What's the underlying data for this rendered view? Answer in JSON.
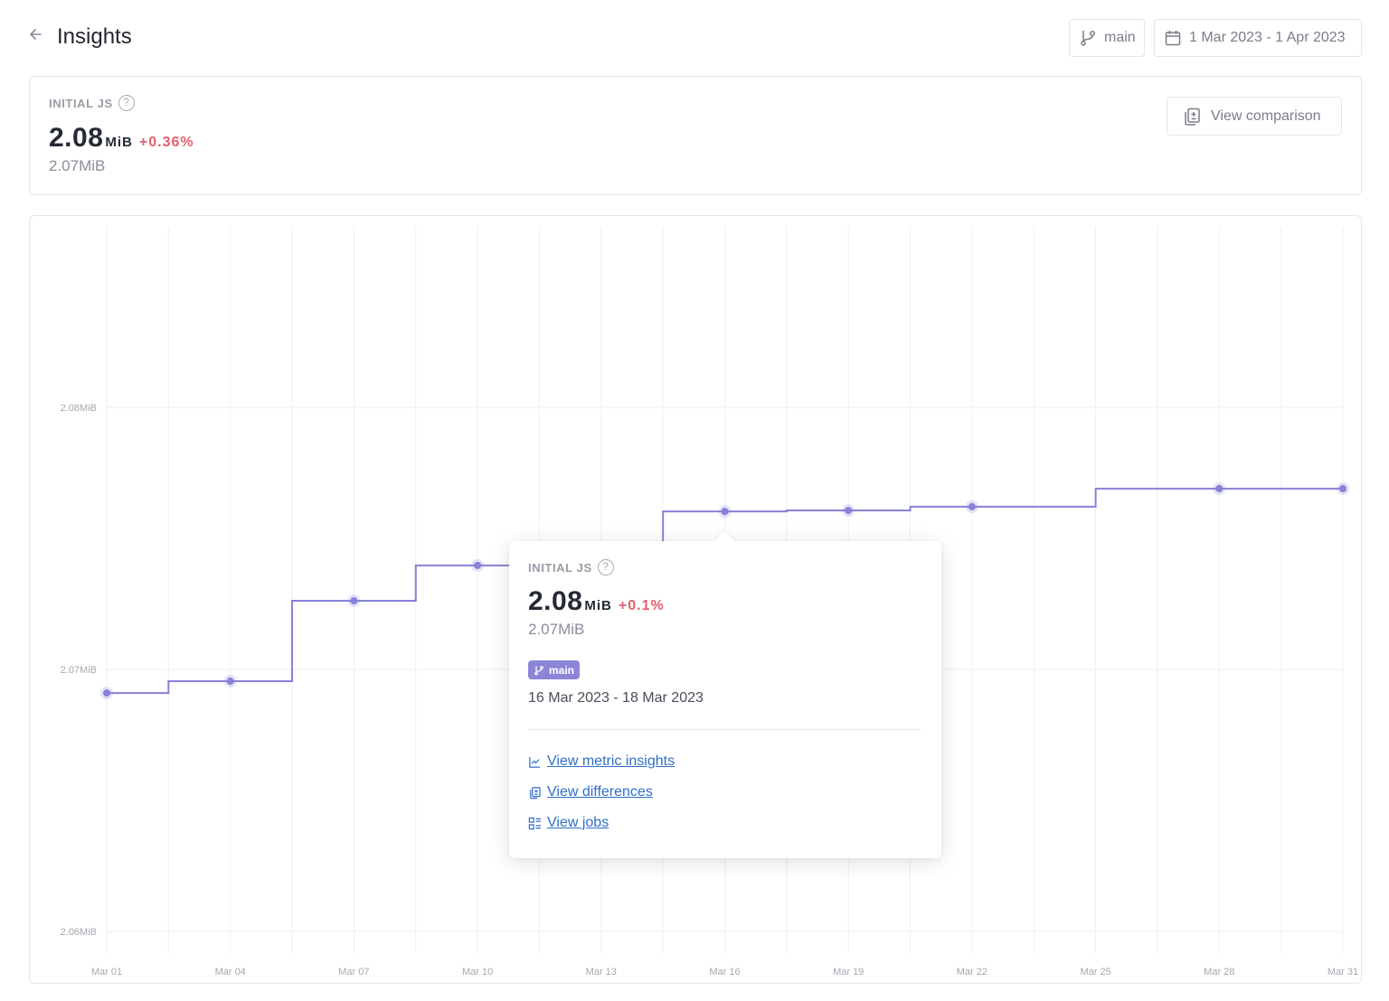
{
  "header": {
    "title": "Insights",
    "back_icon": "arrow-left-icon",
    "branch": "main",
    "date_range": "1 Mar 2023 - 1 Apr 2023"
  },
  "summary": {
    "label": "INITIAL JS",
    "value": "2.08",
    "unit": "MiB",
    "delta": "+0.36%",
    "baseline": "2.07MiB",
    "compare_button": "View comparison"
  },
  "tooltip": {
    "label": "INITIAL JS",
    "value": "2.08",
    "unit": "MiB",
    "delta": "+0.1%",
    "baseline": "2.07MiB",
    "branch_badge": "main",
    "range": "16 Mar 2023 - 18 Mar 2023",
    "links": [
      {
        "icon": "line-chart-icon",
        "label": "View metric insights"
      },
      {
        "icon": "compare-icon",
        "label": "View differences"
      },
      {
        "icon": "list-icon",
        "label": "View jobs"
      }
    ]
  },
  "colors": {
    "accent": "#8b85d8",
    "line": "#8781d9",
    "delta_negative": "#e25f6d",
    "link": "#2f6fc6"
  },
  "chart_data": {
    "type": "line",
    "style": "step",
    "title": "",
    "xlabel": "",
    "ylabel": "",
    "ylim": [
      2.06,
      2.08
    ],
    "yticks": [
      {
        "value": 2.08,
        "label": "2.08MiB"
      },
      {
        "value": 2.07,
        "label": "2.07MiB"
      },
      {
        "value": 2.06,
        "label": "2.06MiB"
      }
    ],
    "xlim_day": [
      1,
      31
    ],
    "xticks": [
      {
        "day": 1,
        "label": "Mar 01"
      },
      {
        "day": 4,
        "label": "Mar 04"
      },
      {
        "day": 7,
        "label": "Mar 07"
      },
      {
        "day": 10,
        "label": "Mar 10"
      },
      {
        "day": 13,
        "label": "Mar 13"
      },
      {
        "day": 16,
        "label": "Mar 16"
      },
      {
        "day": 19,
        "label": "Mar 19"
      },
      {
        "day": 22,
        "label": "Mar 22"
      },
      {
        "day": 25,
        "label": "Mar 25"
      },
      {
        "day": 28,
        "label": "Mar 28"
      },
      {
        "day": 31,
        "label": "Mar 31"
      }
    ],
    "grid": true,
    "series": [
      {
        "name": "main",
        "points": [
          {
            "day": 1,
            "value": 2.0691
          },
          {
            "day": 4,
            "value": 2.06955
          },
          {
            "day": 7,
            "value": 2.07262
          },
          {
            "day": 10,
            "value": 2.07397
          },
          {
            "day": 16,
            "value": 2.07603
          },
          {
            "day": 19,
            "value": 2.07607
          },
          {
            "day": 22,
            "value": 2.07621
          },
          {
            "day": 28,
            "value": 2.0769
          },
          {
            "day": 31,
            "value": 2.0769
          }
        ],
        "step_at_days": [
          2.5,
          5.5,
          8.5,
          14.5,
          17.5,
          20.5,
          25
        ]
      }
    ],
    "highlighted_point_day": 16
  }
}
